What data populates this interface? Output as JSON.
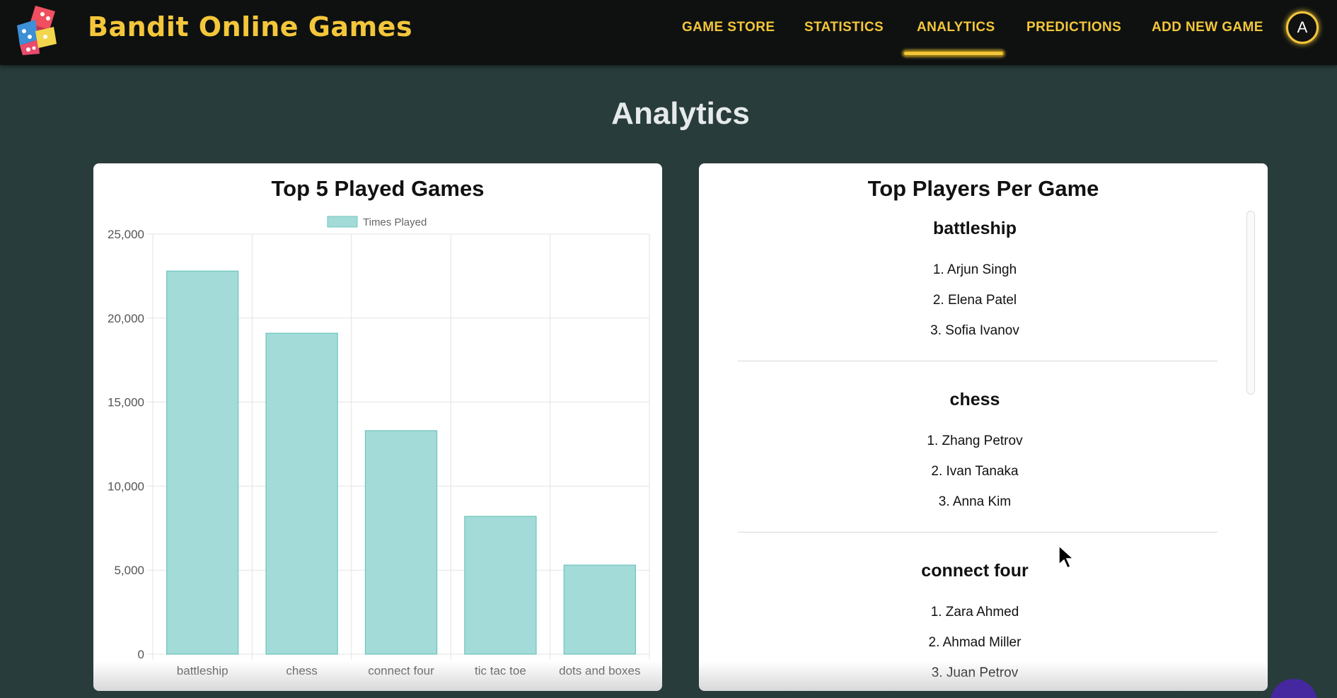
{
  "app": {
    "brand": "Bandit Online Games"
  },
  "nav": {
    "items": [
      "GAME STORE",
      "STATISTICS",
      "ANALYTICS",
      "PREDICTIONS",
      "ADD NEW GAME"
    ],
    "active": "ANALYTICS",
    "avatar_initial": "A"
  },
  "page": {
    "title": "Analytics"
  },
  "colors": {
    "accent": "#f4c63a",
    "bar_fill": "#a3dbd8",
    "bar_border": "#6cc4be"
  },
  "chart_card": {
    "title": "Top 5 Played Games"
  },
  "chart_data": {
    "type": "bar",
    "title": "Top 5 Played Games",
    "categories": [
      "battleship",
      "chess",
      "connect four",
      "tic tac toe",
      "dots and boxes"
    ],
    "series": [
      {
        "name": "Times Played",
        "values": [
          22800,
          19100,
          13300,
          8200,
          5300
        ]
      }
    ],
    "ylim": [
      0,
      25000
    ],
    "yticks": [
      "0",
      "5,000",
      "10,000",
      "15,000",
      "20,000",
      "25,000"
    ],
    "grid": true,
    "legend": "top-center"
  },
  "players_card": {
    "title": "Top Players Per Game",
    "games": [
      {
        "name": "battleship",
        "players": [
          "1.  Arjun Singh",
          "2.  Elena Patel",
          "3.  Sofia Ivanov"
        ]
      },
      {
        "name": "chess",
        "players": [
          "1.  Zhang Petrov",
          "2.  Ivan Tanaka",
          "3.  Anna Kim"
        ]
      },
      {
        "name": "connect four",
        "players": [
          "1.  Zara Ahmed",
          "2.  Ahmad Miller",
          "3.  Juan Petrov"
        ]
      }
    ]
  }
}
